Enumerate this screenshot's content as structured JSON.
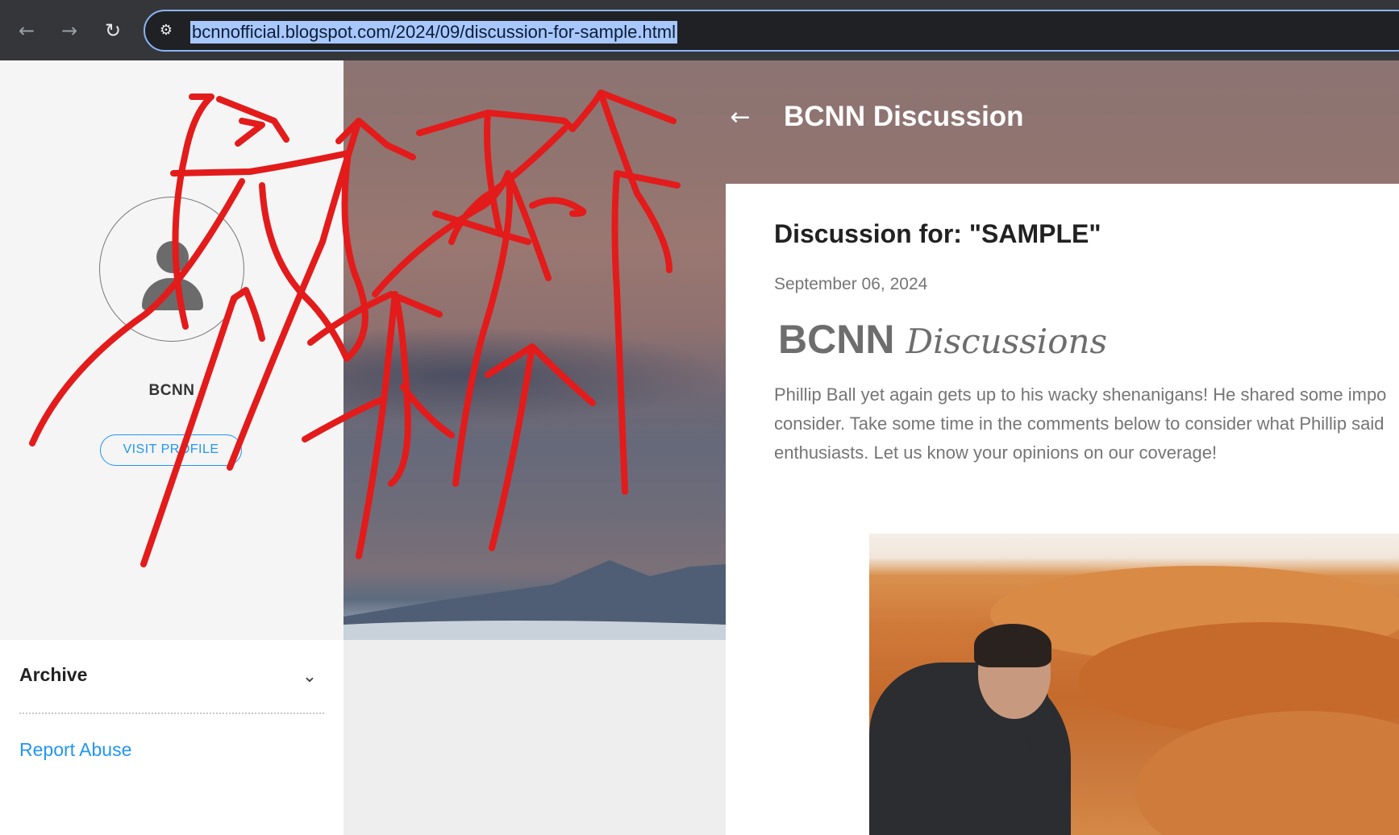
{
  "browser": {
    "url": "bcnnofficial.blogspot.com/2024/09/discussion-for-sample.html",
    "back_icon": "←",
    "forward_icon": "→",
    "reload_icon": "↻",
    "site_settings_icon": "⚙"
  },
  "sidebar": {
    "profile_name": "BCNN",
    "visit_profile_label": "VISIT PROFILE",
    "archive_label": "Archive",
    "archive_chevron": "⌄",
    "report_abuse_label": "Report Abuse"
  },
  "header": {
    "back_icon": "←",
    "blog_title": "BCNN Discussion"
  },
  "post": {
    "title": "Discussion for: \"SAMPLE\"",
    "date": "September 06, 2024",
    "brand_main": "BCNN",
    "brand_script": "Discussions",
    "body_lines": [
      "Phillip Ball yet again gets up to his wacky shenanigans! He shared some impo",
      "consider. Take some time in the comments below to consider what Phillip said",
      "enthusiasts. Let us know your opinions on our coverage!"
    ]
  },
  "colors": {
    "accent": "#2196f3",
    "scribble": "#e31b1b",
    "chrome_bg": "#35363a",
    "url_highlight": "#a8c7fa"
  }
}
